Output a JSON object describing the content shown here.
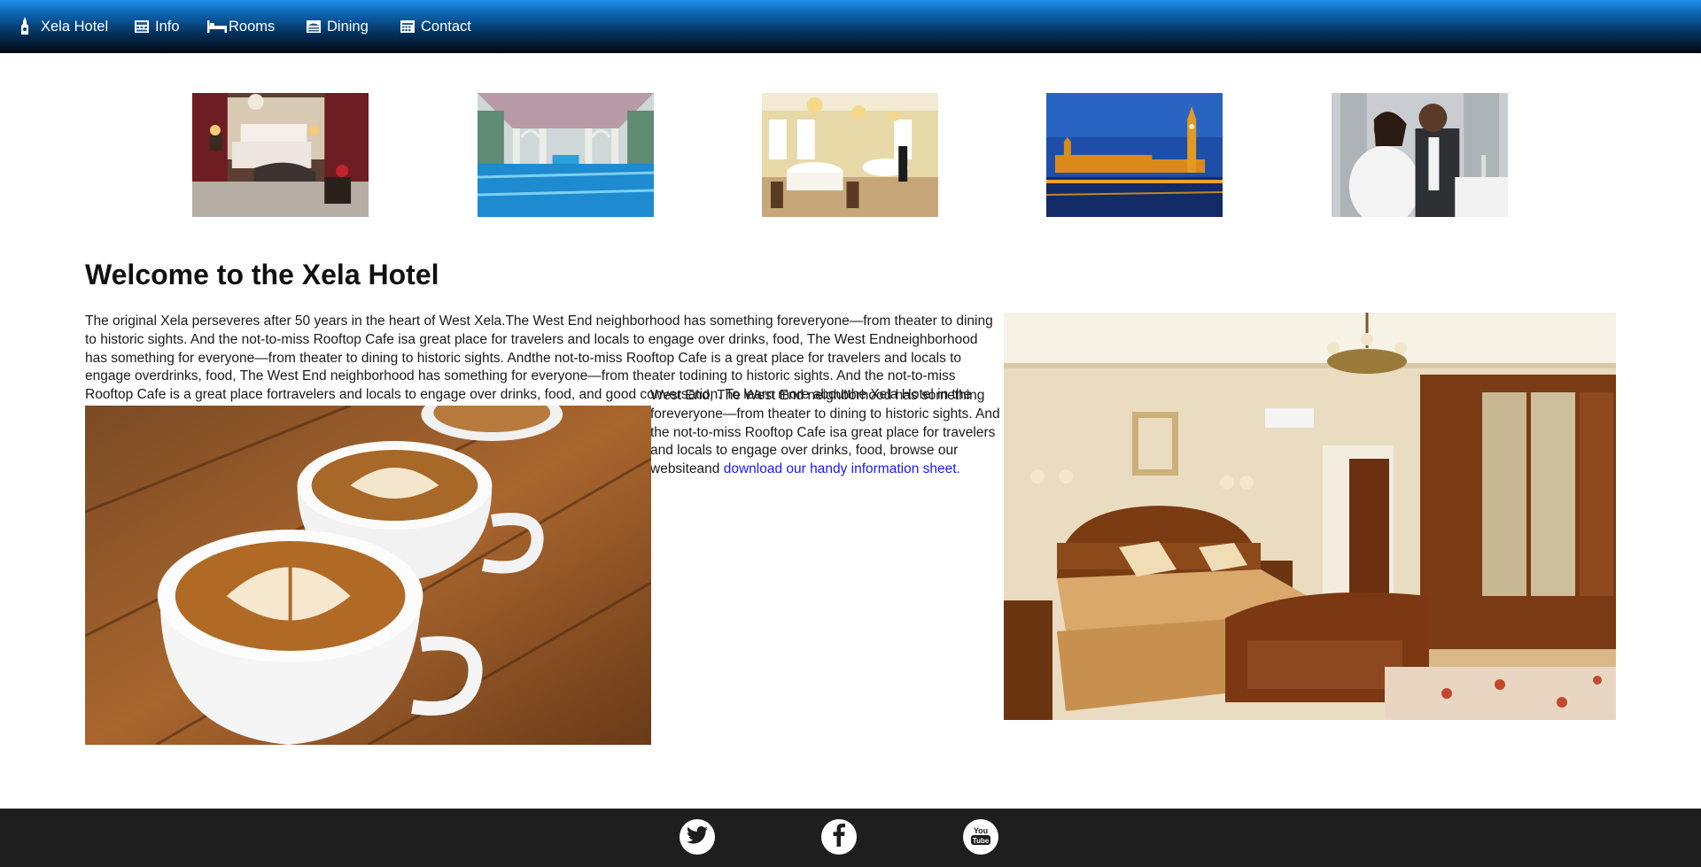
{
  "nav": {
    "brand": "Xela Hotel",
    "items": [
      {
        "label": "Info",
        "icon": "building-icon"
      },
      {
        "label": "Rooms",
        "icon": "bed-icon"
      },
      {
        "label": "Dining",
        "icon": "dining-icon"
      },
      {
        "label": "Contact",
        "icon": "calendar-icon"
      }
    ]
  },
  "gallery": [
    {
      "alt": "Hotel bedroom"
    },
    {
      "alt": "Indoor pool hall"
    },
    {
      "alt": "Dining room"
    },
    {
      "alt": "Big Ben at night"
    },
    {
      "alt": "Couple dining"
    }
  ],
  "main": {
    "title": "Welcome to the Xela Hotel",
    "intro_lines": [
      "The original Xela perseveres after 50 years in the heart of West Xela.The West End neighborhood has something foreveryone—from theater to dining",
      "to historic sights. And the not-to-miss Rooftop Cafe isa great place for travelers and locals to engage over drinks, food, The West Endneighborhood",
      "has something for everyone—from theater to dining to historic sights. Andthe not-to-miss Rooftop Cafe is a great place for travelers and locals to",
      "engage overdrinks, food, The West End neighborhood has something for everyone—from theater todining to historic sights. And the not-to-miss",
      "Rooftop Cafe is a great place fortravelers and locals to engage over drinks, food, and good  conversation.  To learn more aboutthe Xela Hotel in the"
    ],
    "wrap_lines": [
      "West End, The West End neighborhood has something",
      "foreveryone—from theater to dining to historic sights. And",
      "the not-to-miss Rooftop Cafe isa great place for travelers",
      "and locals to engage over drinks, food, browse our"
    ],
    "last_line_prefix": "websiteand",
    "link_text": "download our handy information sheet",
    "link_suffix": "."
  },
  "footer": {
    "social": [
      "twitter-icon",
      "facebook-icon",
      "youtube-icon"
    ]
  },
  "colors": {
    "nav_top": "#1e8fe6",
    "nav_bottom": "#010a14",
    "link": "#1a1aff",
    "footer_bg": "#1e1e1e"
  }
}
